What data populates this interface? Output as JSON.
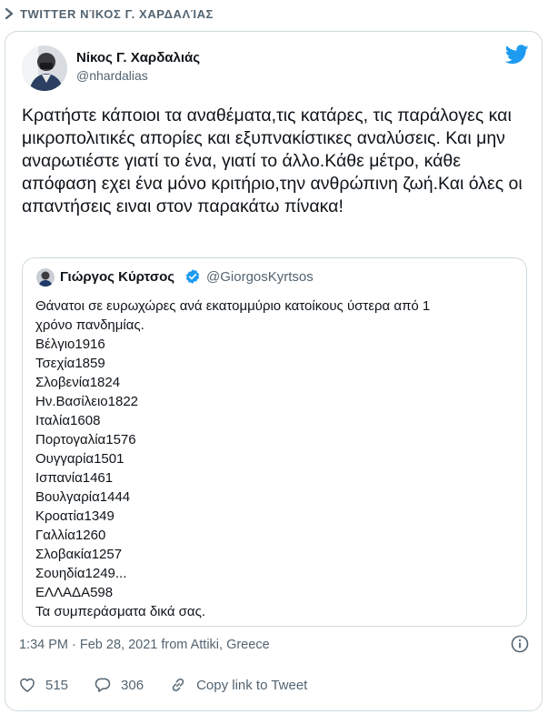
{
  "header": {
    "label": "TWITTER  ΝΊΚΟΣ Γ. ΧΑΡΔΑΛΊΑΣ"
  },
  "tweet": {
    "author_name": "Νίκος Γ. Χαρδαλιάς",
    "author_handle": "@nhardalias",
    "text": "Κρατήστε κάποιοι τα αναθέματα,τις κατάρες, τις παράλογες και μικροπολιτικές απορίες και εξυπνακίστικες αναλύσεις. Και μην αναρωτιέστε  γιατί το ένα, γιατί το άλλο.Κάθε μέτρο, κάθε απόφαση εχει ένα μόνο κριτήριο,την ανθρώπινη ζωή.Και όλες οι απαντήσεις ειναι στον παρακάτω πίνακα!",
    "timestamp": "1:34 PM · Feb 28, 2021 from Attiki, Greece",
    "likes": "515",
    "replies": "306",
    "copy_link": "Copy link to Tweet"
  },
  "quoted": {
    "author_name": "Γιώργος Κύρτσος",
    "author_handle": "@GiorgosKyrtsos",
    "lines": [
      "Θάνατοι σε ευρωχώρες ανά εκατομμύριο κατοίκους ύστερα από 1",
      "χρόνο πανδημίας.",
      "Βέλγιο1916",
      "Τσεχία1859",
      "Σλοβενία1824",
      "Ην.Βασίλειο1822",
      "Ιταλία1608",
      "Πορτογαλία1576",
      "Ουγγαρία1501",
      "Ισπανία1461",
      "Βουλγαρία1444",
      "Κροατία1349",
      "Γαλλία1260",
      "Σλοβακία1257",
      "Σουηδία1249...",
      "ΕΛΛΑΔΑ598",
      "Τα συμπεράσματα δικά σας."
    ]
  },
  "icons": {
    "header": "chevron-right-icon",
    "brand": "twitter-bird-icon",
    "verified": "verified-badge-icon",
    "info": "info-icon",
    "like": "heart-icon",
    "reply": "reply-icon",
    "link": "link-icon"
  },
  "colors": {
    "brand": "#1d9bf0",
    "text": "#0f1419",
    "muted": "#536471",
    "border": "#cfd9de"
  }
}
